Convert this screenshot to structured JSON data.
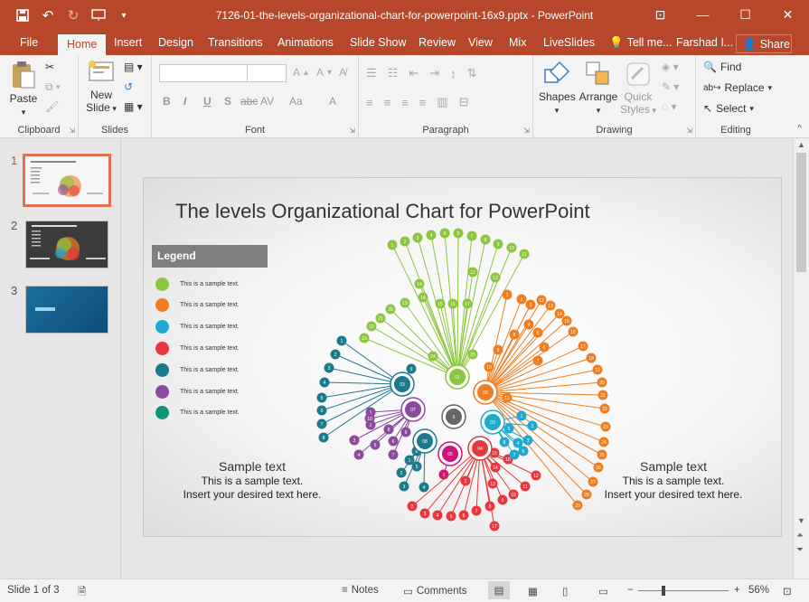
{
  "window": {
    "title": "7126-01-the-levels-organizational-chart-for-powerpoint-16x9.pptx - PowerPoint"
  },
  "tabs": [
    "File",
    "Home",
    "Insert",
    "Design",
    "Transitions",
    "Animations",
    "Slide Show",
    "Review",
    "View",
    "Mix",
    "LiveSlides",
    "Tell me...",
    "Farshad I..."
  ],
  "share_label": "Share",
  "ribbon": {
    "clipboard": {
      "paste": "Paste",
      "label": "Clipboard"
    },
    "slides": {
      "new_slide_1": "New",
      "new_slide_2": "Slide",
      "label": "Slides"
    },
    "font": {
      "label": "Font",
      "b": "B",
      "i": "I",
      "u": "U",
      "s": "S",
      "ab": "abc",
      "av": "AV",
      "aa": "Aa",
      "a": "A"
    },
    "paragraph": {
      "label": "Paragraph"
    },
    "drawing": {
      "shapes": "Shapes",
      "arrange": "Arrange",
      "quick_1": "Quick",
      "quick_2": "Styles",
      "label": "Drawing"
    },
    "editing": {
      "find": "Find",
      "replace": "Replace",
      "select": "Select",
      "label": "Editing"
    }
  },
  "thumbs": [
    {
      "num": "1"
    },
    {
      "num": "2"
    },
    {
      "num": "3"
    }
  ],
  "slide": {
    "title": "The levels Organizational Chart for PowerPoint",
    "legend_title": "Legend",
    "legend": [
      {
        "color": "#8cc63f",
        "text": "This is a sample text."
      },
      {
        "color": "#ef7d22",
        "text": "This is a sample text."
      },
      {
        "color": "#1fa9d1",
        "text": "This is a sample text."
      },
      {
        "color": "#e8383d",
        "text": "This is a sample text."
      },
      {
        "color": "#1d7a8c",
        "text": "This is a sample text."
      },
      {
        "color": "#8c4a9e",
        "text": "This is a sample text."
      },
      {
        "color": "#14927a",
        "text": "This is a sample text."
      }
    ],
    "left_block": {
      "h": "Sample text",
      "l1": "This is a sample text.",
      "l2": "Insert your desired text here."
    },
    "right_block": {
      "h": "Sample text",
      "l1": "This is a sample text.",
      "l2": "Insert your desired text here."
    }
  },
  "status": {
    "slide": "Slide 1 of 3",
    "notes": "Notes",
    "comments": "Comments",
    "zoom": "56%"
  }
}
